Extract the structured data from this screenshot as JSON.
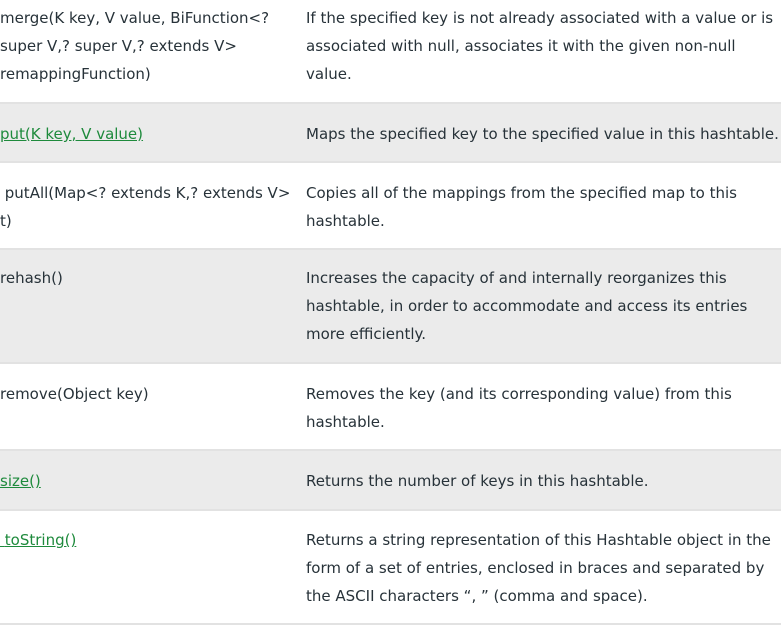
{
  "rows": [
    {
      "method": "merge(K key, V value, BiFunction<? super V,? super V,? extends V> remappingFunction)",
      "linked": false,
      "description": "If the specified key is not already associated with a value or is associated with null, associates it with the given non-null value."
    },
    {
      "method": " put(K key, V value)",
      "linked": true,
      "description": "Maps the specified key to the specified value in this hashtable."
    },
    {
      "method": " putAll(Map<? extends K,? extends V> t)",
      "linked": false,
      "description": "Copies all of the mappings from the specified map to this hashtable."
    },
    {
      "method": "rehash()",
      "linked": false,
      "description": "Increases the capacity of and internally reorganizes this hashtable, in order to accommodate and access its entries more efficiently."
    },
    {
      "method": "remove(Object key)",
      "linked": false,
      "description": "Removes the key (and its corresponding value) from this hashtable."
    },
    {
      "method": "size()",
      "linked": true,
      "description": "Returns the number of keys in this hashtable."
    },
    {
      "method": " toString()",
      "linked": true,
      "description": "Returns a string representation of this Hashtable object in the form of a set of entries, enclosed in braces and separated by the ASCII characters “, ” (comma and space)."
    }
  ],
  "colors": {
    "link": "#1e8a3c",
    "text": "#273239",
    "stripe": "#ebebeb"
  }
}
